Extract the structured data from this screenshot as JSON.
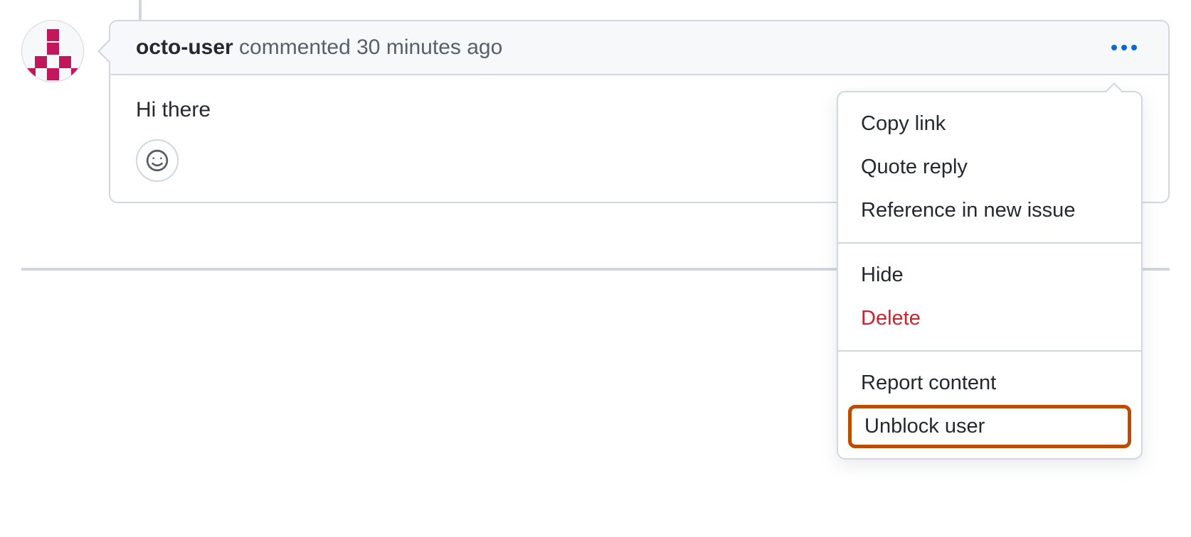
{
  "comment": {
    "author": "octo-user",
    "action_text": "commented",
    "timestamp": "30 minutes ago",
    "body": "Hi there"
  },
  "menu": {
    "copy_link": "Copy link",
    "quote_reply": "Quote reply",
    "reference_issue": "Reference in new issue",
    "hide": "Hide",
    "delete": "Delete",
    "report_content": "Report content",
    "unblock_user": "Unblock user"
  }
}
